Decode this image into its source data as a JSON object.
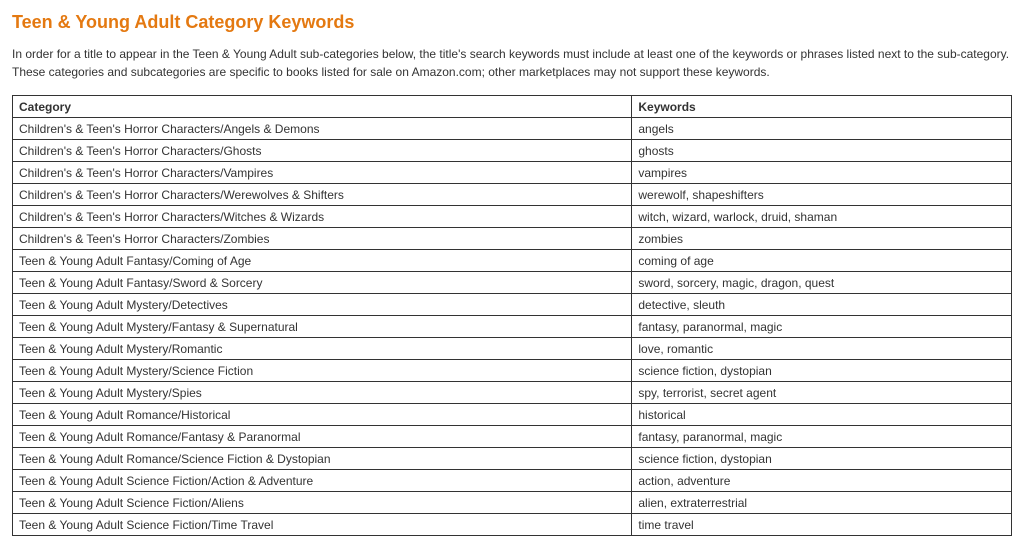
{
  "title": "Teen & Young Adult Category Keywords",
  "intro": "In order for a title to appear in the Teen & Young Adult sub-categories below, the title's search keywords must include at least one of the keywords or phrases listed next to the sub-category. These categories and subcategories are  specific to books listed for sale on Amazon.com; other marketplaces may not support these keywords.",
  "headers": {
    "category": "Category",
    "keywords": "Keywords"
  },
  "rows": [
    {
      "category": "Children's & Teen's Horror Characters/Angels & Demons",
      "keywords": "angels"
    },
    {
      "category": "Children's & Teen's Horror Characters/Ghosts",
      "keywords": "ghosts"
    },
    {
      "category": "Children's & Teen's Horror Characters/Vampires",
      "keywords": "vampires"
    },
    {
      "category": "Children's & Teen's Horror Characters/Werewolves & Shifters",
      "keywords": "werewolf, shapeshifters"
    },
    {
      "category": "Children's & Teen's Horror Characters/Witches & Wizards",
      "keywords": "witch, wizard, warlock, druid, shaman"
    },
    {
      "category": "Children's & Teen's Horror Characters/Zombies",
      "keywords": "zombies"
    },
    {
      "category": "Teen & Young Adult Fantasy/Coming of Age",
      "keywords": "coming of age"
    },
    {
      "category": "Teen & Young Adult Fantasy/Sword & Sorcery",
      "keywords": "sword, sorcery, magic, dragon, quest"
    },
    {
      "category": "Teen & Young Adult Mystery/Detectives",
      "keywords": "detective, sleuth"
    },
    {
      "category": "Teen & Young Adult Mystery/Fantasy & Supernatural",
      "keywords": "fantasy, paranormal, magic"
    },
    {
      "category": "Teen & Young Adult Mystery/Romantic",
      "keywords": "love, romantic"
    },
    {
      "category": "Teen & Young Adult Mystery/Science Fiction",
      "keywords": "science fiction, dystopian"
    },
    {
      "category": "Teen & Young Adult Mystery/Spies",
      "keywords": "spy, terrorist, secret agent"
    },
    {
      "category": "Teen & Young Adult Romance/Historical",
      "keywords": "historical"
    },
    {
      "category": "Teen & Young Adult Romance/Fantasy & Paranormal",
      "keywords": "fantasy, paranormal, magic"
    },
    {
      "category": "Teen & Young Adult Romance/Science Fiction & Dystopian",
      "keywords": "science fiction, dystopian"
    },
    {
      "category": "Teen & Young Adult Science Fiction/Action & Adventure",
      "keywords": "action, adventure"
    },
    {
      "category": "Teen & Young Adult Science Fiction/Aliens",
      "keywords": "alien, extraterrestrial"
    },
    {
      "category": "Teen & Young Adult Science Fiction/Time Travel",
      "keywords": "time travel"
    }
  ]
}
